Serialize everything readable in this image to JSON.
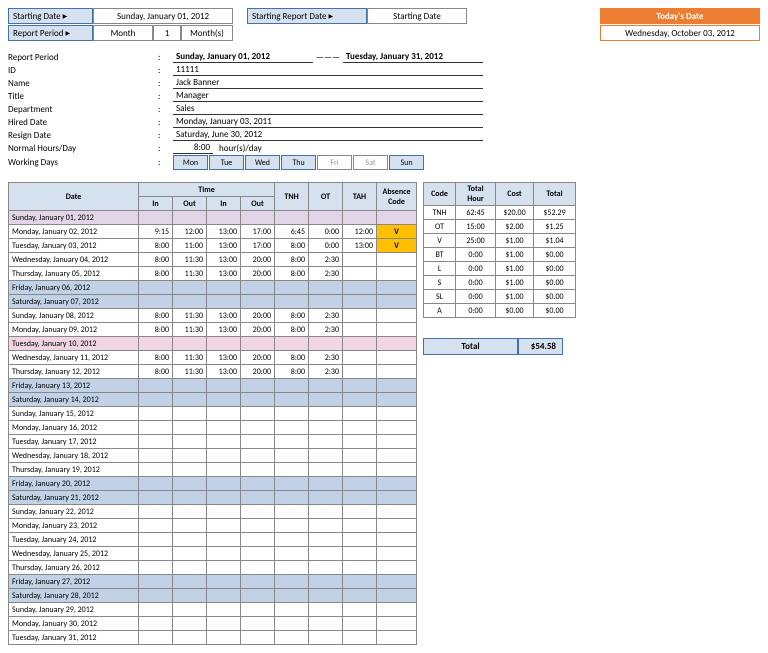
{
  "header": {
    "starting_date_lbl": "Starting Date",
    "starting_date_val": "Sunday, January 01, 2012",
    "starting_report_date_lbl": "Starting Report Date",
    "starting_report_date_val": "Starting Date",
    "todays_date_lbl": "Today's Date",
    "todays_date_val": "Wednesday, October 03, 2012",
    "report_period_lbl": "Report Period",
    "month_lbl": "Month",
    "month_num": "1",
    "month_unit": "Month(s)"
  },
  "info": {
    "report_period_lbl": "Report Period",
    "report_period_from": "Sunday, January 01, 2012",
    "report_period_to": "Tuesday, January 31, 2012",
    "dash": "———",
    "id_lbl": "ID",
    "id_val": "11111",
    "name_lbl": "Name",
    "name_val": "Jack Banner",
    "title_lbl": "Title",
    "title_val": "Manager",
    "dept_lbl": "Department",
    "dept_val": "Sales",
    "hired_lbl": "Hired Date",
    "hired_val": "Monday, January 03, 2011",
    "resign_lbl": "Resign Date",
    "resign_val": "Saturday, June 30, 2012",
    "hours_lbl": "Normal Hours/Day",
    "hours_val": "8:00",
    "hours_unit": "hour(s)/day",
    "working_days_lbl": "Working Days",
    "days": [
      "Mon",
      "Tue",
      "Wed",
      "Thu",
      "Fri",
      "Sat",
      "Sun"
    ],
    "days_on": [
      true,
      true,
      true,
      true,
      false,
      false,
      true
    ]
  },
  "main_headers": {
    "date": "Date",
    "time": "Time",
    "in": "In",
    "out": "Out",
    "tnh": "TNH",
    "ot": "OT",
    "tah": "TAH",
    "abs": "Absence Code"
  },
  "rows": [
    {
      "cls": "row-purple",
      "date": "Sunday, January 01, 2012"
    },
    {
      "cls": "row-white",
      "date": "Monday, January 02, 2012",
      "in1": "9:15",
      "out1": "12:00",
      "in2": "13:00",
      "out2": "17:00",
      "tnh": "6:45",
      "ot": "0:00",
      "tah": "12:00",
      "abs": "V"
    },
    {
      "cls": "row-white",
      "date": "Tuesday, January 03, 2012",
      "in1": "8:00",
      "out1": "11:00",
      "in2": "13:00",
      "out2": "17:00",
      "tnh": "8:00",
      "ot": "0:00",
      "tah": "13:00",
      "abs": "V"
    },
    {
      "cls": "row-white",
      "date": "Wednesday, January 04, 2012",
      "in1": "8:00",
      "out1": "11:30",
      "in2": "13:00",
      "out2": "20:00",
      "tnh": "8:00",
      "ot": "2:30"
    },
    {
      "cls": "row-white",
      "date": "Thursday, January 05, 2012",
      "in1": "8:00",
      "out1": "11:30",
      "in2": "13:00",
      "out2": "20:00",
      "tnh": "8:00",
      "ot": "2:30"
    },
    {
      "cls": "row-blue",
      "date": "Friday, January 06, 2012"
    },
    {
      "cls": "row-blue",
      "date": "Saturday, January 07, 2012"
    },
    {
      "cls": "row-white",
      "date": "Sunday, January 08, 2012",
      "in1": "8:00",
      "out1": "11:30",
      "in2": "13:00",
      "out2": "20:00",
      "tnh": "8:00",
      "ot": "2:30"
    },
    {
      "cls": "row-white",
      "date": "Monday, January 09, 2012",
      "in1": "8:00",
      "out1": "11:30",
      "in2": "13:00",
      "out2": "20:00",
      "tnh": "8:00",
      "ot": "2:30"
    },
    {
      "cls": "row-pink",
      "date": "Tuesday, January 10, 2012"
    },
    {
      "cls": "row-white",
      "date": "Wednesday, January 11, 2012",
      "in1": "8:00",
      "out1": "11:30",
      "in2": "13:00",
      "out2": "20:00",
      "tnh": "8:00",
      "ot": "2:30"
    },
    {
      "cls": "row-white",
      "date": "Thursday, January 12, 2012",
      "in1": "8:00",
      "out1": "11:30",
      "in2": "13:00",
      "out2": "20:00",
      "tnh": "8:00",
      "ot": "2:30"
    },
    {
      "cls": "row-blue",
      "date": "Friday, January 13, 2012"
    },
    {
      "cls": "row-blue",
      "date": "Saturday, January 14, 2012"
    },
    {
      "cls": "row-white",
      "date": "Sunday, January 15, 2012"
    },
    {
      "cls": "row-white",
      "date": "Monday, January 16, 2012"
    },
    {
      "cls": "row-white",
      "date": "Tuesday, January 17, 2012"
    },
    {
      "cls": "row-white",
      "date": "Wednesday, January 18, 2012"
    },
    {
      "cls": "row-white",
      "date": "Thursday, January 19, 2012"
    },
    {
      "cls": "row-blue",
      "date": "Friday, January 20, 2012"
    },
    {
      "cls": "row-blue",
      "date": "Saturday, January 21, 2012"
    },
    {
      "cls": "row-white",
      "date": "Sunday, January 22, 2012"
    },
    {
      "cls": "row-white",
      "date": "Monday, January 23, 2012"
    },
    {
      "cls": "row-white",
      "date": "Tuesday, January 24, 2012"
    },
    {
      "cls": "row-white",
      "date": "Wednesday, January 25, 2012"
    },
    {
      "cls": "row-white",
      "date": "Thursday, January 26, 2012"
    },
    {
      "cls": "row-blue",
      "date": "Friday, January 27, 2012"
    },
    {
      "cls": "row-blue",
      "date": "Saturday, January 28, 2012"
    },
    {
      "cls": "row-white",
      "date": "Sunday, January 29, 2012"
    },
    {
      "cls": "row-white",
      "date": "Monday, January 30, 2012"
    },
    {
      "cls": "row-white",
      "date": "Tuesday, January 31, 2012"
    }
  ],
  "side_headers": {
    "code": "Code",
    "hour": "Total Hour",
    "cost": "Cost",
    "total": "Total"
  },
  "side_rows": [
    {
      "code": "TNH",
      "hour": "62:45",
      "cost": "$20.00",
      "total": "$52.29"
    },
    {
      "code": "OT",
      "hour": "15:00",
      "cost": "$2.00",
      "total": "$1.25"
    },
    {
      "code": "V",
      "hour": "25:00",
      "cost": "$1.00",
      "total": "$1.04"
    },
    {
      "code": "BT",
      "hour": "0:00",
      "cost": "$1.00",
      "total": "$0.00"
    },
    {
      "code": "L",
      "hour": "0:00",
      "cost": "$1.00",
      "total": "$0.00"
    },
    {
      "code": "S",
      "hour": "0:00",
      "cost": "$1.00",
      "total": "$0.00"
    },
    {
      "code": "SL",
      "hour": "0:00",
      "cost": "$1.00",
      "total": "$0.00"
    },
    {
      "code": "A",
      "hour": "0:00",
      "cost": "$0.00",
      "total": "$0.00"
    }
  ],
  "grand_total": {
    "lbl": "Total",
    "val": "$54.58"
  }
}
